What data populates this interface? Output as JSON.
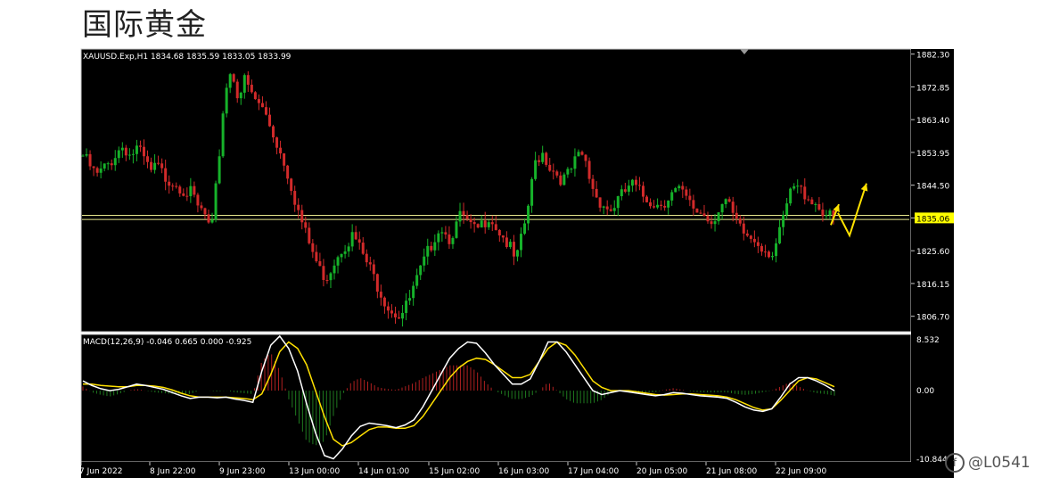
{
  "page": {
    "title": "国际黄金"
  },
  "watermark": {
    "icon": "f",
    "text": "@L0541"
  },
  "chart_data": {
    "type": "candlestick",
    "symbol_header": "XAUUSD.Exp,H1  1834.68 1835.59 1833.05 1833.99",
    "price_axis": {
      "range": [
        1802.5,
        1883.5
      ],
      "tick_values": [
        1882.3,
        1872.85,
        1863.4,
        1853.95,
        1844.5,
        1835.06,
        1825.6,
        1816.15,
        1806.7
      ],
      "tick_labels": [
        "1882.30",
        "1872.85",
        "1863.40",
        "1853.95",
        "1844.50",
        "1835.06",
        "1825.60",
        "1816.15",
        "1806.70"
      ],
      "current_price": 1835.06,
      "current_price_label": "1835.06",
      "horizontal_lines": [
        1835.8,
        1834.6
      ]
    },
    "x_labels": [
      "7 Jun 2022",
      "8 Jun 22:00",
      "9 Jun 23:00",
      "13 Jun 00:00",
      "14 Jun 01:00",
      "15 Jun 02:00",
      "16 Jun 03:00",
      "17 Jun 04:00",
      "20 Jun 05:00",
      "21 Jun 08:00",
      "22 Jun 09:00"
    ],
    "colors": {
      "up": "#16b22a",
      "down": "#d12a2a",
      "background": "#000000",
      "level_line": "#e6e68c",
      "arrow": "#ffe200",
      "current_price_box": "#ffff00"
    },
    "close_path": [
      1853,
      1850,
      1847,
      1849,
      1851,
      1854,
      1856,
      1853,
      1855,
      1852,
      1848,
      1850,
      1847,
      1846,
      1845,
      1843,
      1842,
      1838,
      1836,
      1830,
      1850,
      1872,
      1878,
      1870,
      1875,
      1870,
      1868,
      1865,
      1860,
      1855,
      1850,
      1843,
      1836,
      1830,
      1825,
      1820,
      1818,
      1822,
      1826,
      1828,
      1830,
      1826,
      1822,
      1818,
      1814,
      1810,
      1808,
      1807,
      1810,
      1815,
      1820,
      1825,
      1830,
      1833,
      1829,
      1832,
      1836,
      1833,
      1831,
      1833,
      1836,
      1833,
      1830,
      1827,
      1822,
      1830,
      1840,
      1852,
      1854,
      1850,
      1848,
      1846,
      1848,
      1852,
      1853,
      1846,
      1841,
      1839,
      1837,
      1840,
      1842,
      1845,
      1843,
      1841,
      1840,
      1839,
      1840,
      1842,
      1843,
      1841,
      1838,
      1837,
      1836,
      1834,
      1838,
      1840,
      1836,
      1832,
      1830,
      1829,
      1828,
      1826,
      1825,
      1830,
      1838,
      1844,
      1843,
      1842,
      1840,
      1838,
      1836,
      1834
    ],
    "forecast_arrows": [
      {
        "points": [
          [
            1833.0,
            0
          ],
          [
            1839.0,
            1
          ]
        ]
      },
      {
        "points": [
          [
            1836.5,
            0
          ],
          [
            1830.0,
            1
          ],
          [
            1845.0,
            2
          ]
        ]
      }
    ],
    "macd": {
      "header": "MACD(12,26,9) -0.046 0.665 0.000 -0.925",
      "range": [
        -10.844,
        8.532
      ],
      "tick_values": [
        8.532,
        0.0,
        -10.844
      ],
      "tick_labels": [
        "8.532",
        "0.00",
        "-10.844"
      ],
      "main_line": [
        1.5,
        0.8,
        0.3,
        0.0,
        0.2,
        0.6,
        1.0,
        0.8,
        0.5,
        0.2,
        -0.3,
        -0.8,
        -1.2,
        -1.0,
        -1.0,
        -1.1,
        -1.0,
        -1.3,
        -1.5,
        -1.8,
        3.0,
        7.0,
        8.4,
        6.5,
        3.0,
        -2.0,
        -6.5,
        -10.0,
        -10.5,
        -9.0,
        -7.0,
        -5.5,
        -5.0,
        -5.2,
        -5.4,
        -5.7,
        -5.3,
        -4.5,
        -2.5,
        0.0,
        2.5,
        5.0,
        6.5,
        7.5,
        7.3,
        5.8,
        4.0,
        2.5,
        1.0,
        1.0,
        1.8,
        4.5,
        7.5,
        7.5,
        6.0,
        4.0,
        2.0,
        0.0,
        -0.6,
        -0.3,
        0.0,
        -0.2,
        -0.4,
        -0.6,
        -0.8,
        -0.6,
        -0.3,
        -0.4,
        -0.6,
        -0.8,
        -0.9,
        -1.0,
        -1.2,
        -1.8,
        -2.5,
        -3.0,
        -3.2,
        -2.8,
        -1.0,
        1.0,
        2.0,
        2.0,
        1.5,
        0.8,
        0.0
      ],
      "signal_line": [
        1.0,
        1.0,
        0.8,
        0.7,
        0.6,
        0.6,
        0.8,
        0.8,
        0.7,
        0.5,
        0.1,
        -0.4,
        -0.8,
        -1.0,
        -1.0,
        -1.0,
        -1.0,
        -1.1,
        -1.2,
        -1.4,
        -0.5,
        2.5,
        6.0,
        7.5,
        6.5,
        4.0,
        0.0,
        -4.0,
        -7.5,
        -8.5,
        -8.0,
        -7.0,
        -6.0,
        -5.6,
        -5.6,
        -5.8,
        -5.8,
        -5.4,
        -4.0,
        -2.0,
        0.0,
        2.0,
        3.5,
        4.5,
        5.0,
        4.8,
        4.0,
        3.0,
        2.0,
        2.0,
        2.5,
        4.5,
        6.5,
        7.5,
        7.0,
        5.5,
        3.5,
        1.5,
        0.5,
        0.0,
        0.0,
        0.0,
        -0.2,
        -0.4,
        -0.6,
        -0.7,
        -0.6,
        -0.5,
        -0.5,
        -0.6,
        -0.7,
        -0.8,
        -1.0,
        -1.4,
        -2.0,
        -2.6,
        -3.0,
        -2.8,
        -1.5,
        0.0,
        1.5,
        2.0,
        1.8,
        1.2,
        0.6
      ]
    }
  }
}
